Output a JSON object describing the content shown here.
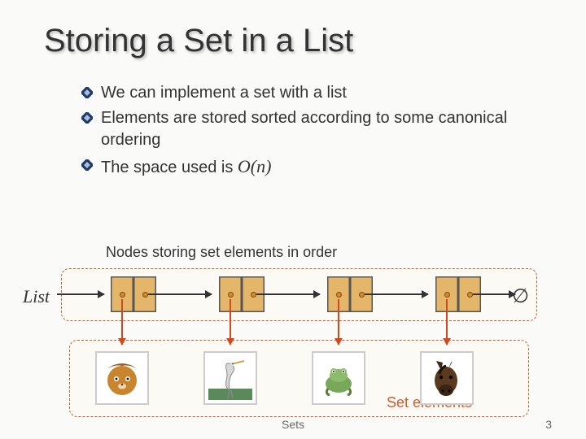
{
  "title": "Storing a Set in a List",
  "bullets": [
    {
      "text": "We can implement a set with a list"
    },
    {
      "text": "Elements are stored sorted according to some canonical ordering"
    },
    {
      "prefix": "The space used is ",
      "bigO": "O",
      "paren_open": "(",
      "var": "n",
      "paren_close": ")"
    }
  ],
  "captions": {
    "nodes": "Nodes storing set elements in order",
    "list": "List",
    "empty_set": "∅",
    "set_elements": "Set elements"
  },
  "footer": {
    "center": "Sets",
    "page": "3"
  },
  "images": {
    "alt1": "lion",
    "alt2": "heron",
    "alt3": "frog",
    "alt4": "horse"
  }
}
